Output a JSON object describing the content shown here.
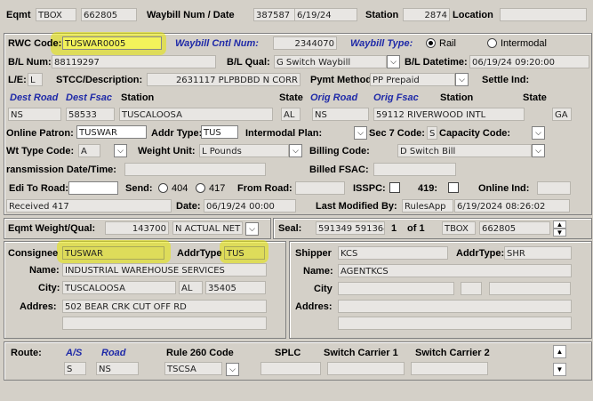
{
  "top": {
    "eqmt_label": "Eqmt",
    "eqmt_init": "TBOX",
    "eqmt_num": "662805",
    "waybill_label": "Waybill Num / Date",
    "waybill_num": "387587",
    "waybill_date": "6/19/24",
    "station_label": "Station",
    "station_val": "2874",
    "location_label": "Location"
  },
  "rwc": {
    "rwc_code_label": "RWC Code:",
    "rwc_code": "TUSWAR0005",
    "cntl_label": "Waybill Cntl Num:",
    "cntl_val": "2344070",
    "type_label": "Waybill Type:",
    "type_rail": "Rail",
    "type_intermodal": "Intermodal",
    "bl_num_label": "B/L Num:",
    "bl_num": "88119297",
    "bl_qual_label": "B/L Qual:",
    "bl_qual": "G Switch Waybill",
    "bl_dt_label": "B/L Datetime:",
    "bl_dt": "06/19/24 09:20:00",
    "le_label": "L/E:",
    "le_val": "L",
    "stcc_label": "STCC/Description:",
    "stcc_val": "2631117 PLPBDBD N CORR",
    "pymt_label": "Pymt Method:",
    "pymt_val": "PP Prepaid",
    "settle_label": "Settle Ind:",
    "dest_road_label": "Dest Road",
    "dest_fsac_label": "Dest Fsac",
    "dest_station_label": "Station",
    "dest_state_label": "State",
    "orig_road_label": "Orig Road",
    "orig_fsac_label": "Orig Fsac",
    "orig_station_label": "Station",
    "orig_state_label": "State",
    "dest_road": "NS",
    "dest_fsac": "58533",
    "dest_station": "TUSCALOOSA",
    "dest_state": "AL",
    "orig_road": "NS",
    "orig_fsac_station": "59112  RIVERWOOD INTL",
    "orig_state": "GA",
    "online_patron_label": "Online Patron:",
    "online_patron": "TUSWAR",
    "addr_type_label": "Addr Type:",
    "addr_type": "TUS",
    "intermodal_plan_label": "Intermodal Plan:",
    "sec7_label": "Sec 7 Code:",
    "sec7_val": "S",
    "capacity_label": "Capacity Code:",
    "wt_type_label": "Wt Type Code:",
    "wt_type": "A",
    "weight_unit_label": "Weight Unit:",
    "weight_unit": "L Pounds",
    "billing_code_label": "Billing Code:",
    "billing_code": "D Switch Bill",
    "trans_dt_label": "ransmission Date/Time:",
    "billed_fsac_label": "Billed FSAC:",
    "edi_label": "Edi To Road:",
    "send_label": "Send:",
    "send_404": "404",
    "send_417": "417",
    "from_road_label": "From Road:",
    "isspc_label": "ISSPC:",
    "n419_label": "419:",
    "online_ind_label": "Online Ind:",
    "received": "Received 417",
    "date_label": "Date:",
    "date_val": "06/19/24 00:00",
    "modified_label": "Last Modified By:",
    "modified_user": "RulesApp",
    "modified_dt": "6/19/2024 08:26:02"
  },
  "weight": {
    "label": "Eqmt Weight/Qual:",
    "value": "143700",
    "qual": "N ACTUAL NET"
  },
  "seal": {
    "label": "Seal:",
    "value": "591349 591364",
    "pos": "1",
    "of": "of 1",
    "init": "TBOX",
    "num": "662805"
  },
  "consignee": {
    "label": "Consignee",
    "code": "TUSWAR",
    "addr_type_label": "AddrType",
    "addr_type": "TUS",
    "name_label": "Name:",
    "name": "INDUSTRIAL WAREHOUSE SERVICES",
    "city_label": "City:",
    "city": "TUSCALOOSA",
    "state": "AL",
    "zip": "35405",
    "address_label": "Addres:",
    "address": "502 BEAR CRK CUT OFF RD"
  },
  "shipper": {
    "label": "Shipper",
    "code": "KCS",
    "addr_type_label": "AddrType:",
    "addr_type": "SHR",
    "name_label": "Name:",
    "name": "AGENTKCS",
    "city_label": "City",
    "address_label": "Addres:"
  },
  "route": {
    "label": "Route:",
    "as_label": "A/S",
    "road_label": "Road",
    "rule260_label": "Rule 260 Code",
    "splc_label": "SPLC",
    "sw1_label": "Switch Carrier 1",
    "sw2_label": "Switch Carrier 2",
    "as_val": "S",
    "road_val": "NS",
    "rule260_val": "TSCSA"
  },
  "icons": {
    "dropdown": "chevron-down-icon",
    "scroll_up": "scroll-up-icon",
    "scroll_down": "scroll-down-icon"
  },
  "colors": {
    "background": "#d4d0c8",
    "highlight": "#e6e600",
    "label_blue": "#1f2aa8"
  }
}
